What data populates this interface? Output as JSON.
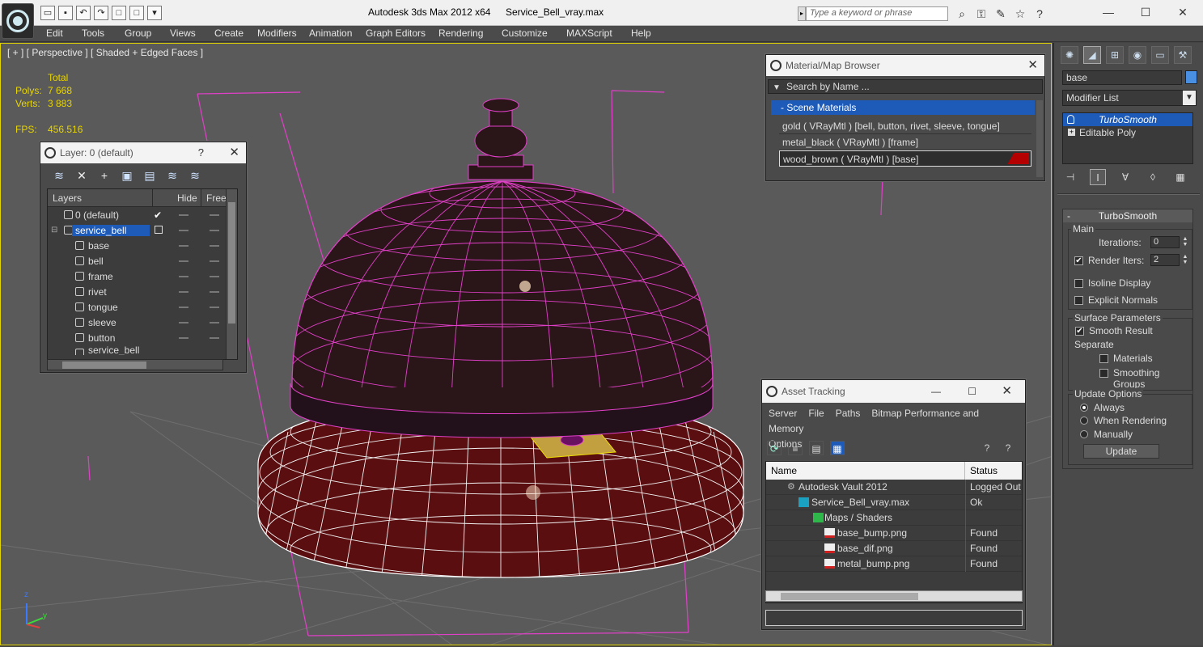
{
  "window": {
    "app_title": "Autodesk 3ds Max  2012 x64",
    "file_name": "Service_Bell_vray.max",
    "search_placeholder": "Type a keyword or phrase",
    "minimize": "—",
    "maximize": "☐",
    "close": "✕"
  },
  "menu": [
    "Edit",
    "Tools",
    "Group",
    "Views",
    "Create",
    "Modifiers",
    "Animation",
    "Graph Editors",
    "Rendering",
    "Customize",
    "MAXScript",
    "Help"
  ],
  "viewport": {
    "label": "[ + ] [ Perspective ] [ Shaded + Edged Faces ]",
    "stats": {
      "total_label": "Total",
      "polys_label": "Polys:",
      "polys_value": "7 668",
      "verts_label": "Verts:",
      "verts_value": "3 883",
      "fps_label": "FPS:",
      "fps_value": "456.516"
    },
    "axis_z": "z",
    "axis_y": "y"
  },
  "layer_panel": {
    "title": "Layer: 0 (default)",
    "help": "?",
    "close": "✕",
    "col_layers": "Layers",
    "col_hide": "Hide",
    "col_freeze": "Free:",
    "rows": [
      {
        "name": "0 (default)"
      },
      {
        "name": "service_bell"
      },
      {
        "name": "base"
      },
      {
        "name": "bell"
      },
      {
        "name": "frame"
      },
      {
        "name": "rivet"
      },
      {
        "name": "tongue"
      },
      {
        "name": "sleeve"
      },
      {
        "name": "button"
      },
      {
        "name": "service_bell"
      }
    ]
  },
  "material_browser": {
    "title": "Material/Map Browser",
    "close": "✕",
    "search_placeholder": "Search by Name ...",
    "group": "- Scene Materials",
    "items": [
      "gold  ( VRayMtl ) [bell, button, rivet, sleeve, tongue]",
      "metal_black  ( VRayMtl ) [frame]",
      "wood_brown  ( VRayMtl ) [base]"
    ],
    "accent_color": "#b40000"
  },
  "asset_tracking": {
    "title": "Asset Tracking",
    "menu": [
      "Server",
      "File",
      "Paths",
      "Bitmap Performance and Memory",
      "Options"
    ],
    "col_name": "Name",
    "col_status": "Status",
    "rows": [
      {
        "name": "Autodesk Vault 2012",
        "status": "Logged Out"
      },
      {
        "name": "Service_Bell_vray.max",
        "status": "Ok"
      },
      {
        "name": "Maps / Shaders",
        "status": ""
      },
      {
        "name": "base_bump.png",
        "status": "Found"
      },
      {
        "name": "base_dif.png",
        "status": "Found"
      },
      {
        "name": "metal_bump.png",
        "status": "Found"
      }
    ]
  },
  "command_panel": {
    "object_name": "base",
    "object_color": "#4a90e2",
    "modifier_list": "Modifier List",
    "stack": [
      "TurboSmooth",
      "Editable Poly"
    ],
    "rollout_title": "TurboSmooth",
    "main_label": "Main",
    "iterations_label": "Iterations:",
    "iterations_value": "0",
    "render_iters_label": "Render Iters:",
    "render_iters_value": "2",
    "isoline_label": "Isoline Display",
    "explicit_label": "Explicit Normals",
    "surface_label": "Surface Parameters",
    "smooth_result_label": "Smooth Result",
    "separate_label": "Separate",
    "materials_label": "Materials",
    "smoothing_groups_label": "Smoothing Groups",
    "update_options_label": "Update Options",
    "always_label": "Always",
    "when_rendering_label": "When Rendering",
    "manually_label": "Manually",
    "update_button": "Update"
  },
  "colors": {
    "wire": "#e040c8",
    "bell_fill": "#2a1518",
    "base_fill": "#5a0e10",
    "selection": "#1e5bb8",
    "stats": "#e7d400"
  }
}
